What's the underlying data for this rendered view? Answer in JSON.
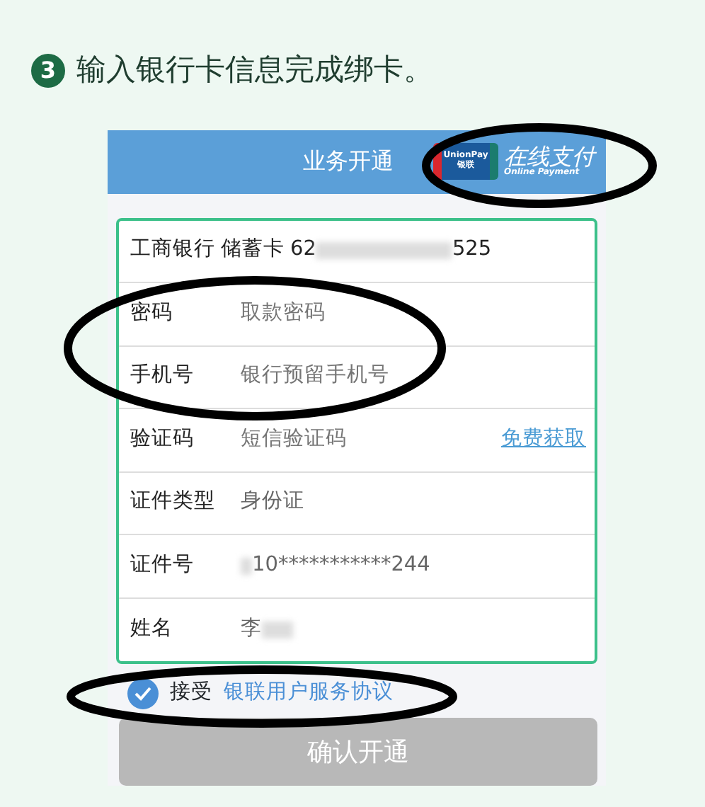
{
  "heading": {
    "step": "3",
    "text": "输入银行卡信息完成绑卡。"
  },
  "header": {
    "title": "业务开通",
    "logo_top": "UnionPay",
    "logo_bottom": "银联",
    "logo_text": "在线支付",
    "logo_sub": "Online Payment"
  },
  "card_row": {
    "bank": "工商银行",
    "type": "储蓄卡",
    "number_start": "62",
    "number_end": "525"
  },
  "fields": [
    {
      "kind": "input",
      "label": "密码",
      "placeholder": "取款密码"
    },
    {
      "kind": "input",
      "label": "手机号",
      "placeholder": "银行预留手机号"
    },
    {
      "kind": "code",
      "label": "验证码",
      "placeholder": "短信验证码",
      "action": "免费获取"
    },
    {
      "kind": "value",
      "label": "证件类型",
      "value": "身份证"
    },
    {
      "kind": "masked",
      "label": "证件号",
      "value": "10***********244"
    },
    {
      "kind": "masked",
      "label": "姓名",
      "value": "李"
    }
  ],
  "agreement": {
    "checked": true,
    "text": "接受",
    "link": "银联用户服务协议"
  },
  "submit": {
    "label": "确认开通",
    "disabled": true
  }
}
